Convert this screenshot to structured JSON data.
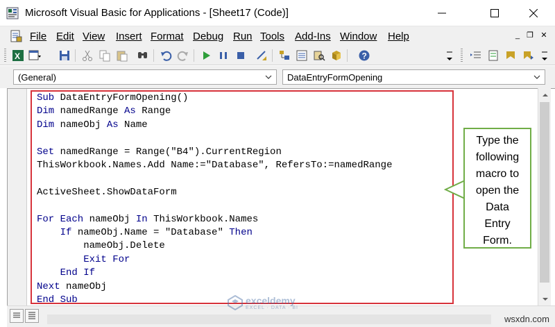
{
  "window": {
    "title": "Microsoft Visual Basic for Applications - [Sheet17 (Code)]",
    "app_icon": "vba-app-icon",
    "controls": [
      "minimize-icon",
      "maximize-icon",
      "close-icon"
    ]
  },
  "menu": {
    "items": [
      {
        "label": "File"
      },
      {
        "label": "Edit"
      },
      {
        "label": "View"
      },
      {
        "label": "Insert"
      },
      {
        "label": "Format"
      },
      {
        "label": "Debug"
      },
      {
        "label": "Run"
      },
      {
        "label": "Tools"
      },
      {
        "label": "Add-Ins"
      },
      {
        "label": "Window"
      },
      {
        "label": "Help"
      }
    ],
    "mdi_minimize": "_",
    "mdi_restore": "❐",
    "mdi_close": "✕"
  },
  "toolbar": {
    "icons": [
      "view-excel-icon",
      "insert-userform-icon",
      "save-icon",
      "cut-icon",
      "copy-icon",
      "paste-icon",
      "find-icon",
      "undo-icon",
      "redo-icon",
      "run-icon",
      "break-icon",
      "reset-icon",
      "design-mode-icon",
      "project-explorer-icon",
      "properties-window-icon",
      "object-browser-icon",
      "toolbox-icon",
      "help-icon"
    ]
  },
  "combos": {
    "object": "(General)",
    "procedure": "DataEntryFormOpening"
  },
  "code": {
    "lines": [
      [
        {
          "t": "Sub ",
          "k": true
        },
        {
          "t": "DataEntryFormOpening()"
        }
      ],
      [
        {
          "t": "Dim ",
          "k": true
        },
        {
          "t": "namedRange "
        },
        {
          "t": "As ",
          "k": true
        },
        {
          "t": "Range"
        }
      ],
      [
        {
          "t": "Dim ",
          "k": true
        },
        {
          "t": "nameObj "
        },
        {
          "t": "As ",
          "k": true
        },
        {
          "t": "Name"
        }
      ],
      [],
      [
        {
          "t": "Set ",
          "k": true
        },
        {
          "t": "namedRange = Range(\"B4\").CurrentRegion"
        }
      ],
      [
        {
          "t": "ThisWorkbook.Names.Add Name:=\"Database\", RefersTo:=namedRange"
        }
      ],
      [],
      [
        {
          "t": "ActiveSheet.ShowDataForm"
        }
      ],
      [],
      [
        {
          "t": "For Each ",
          "k": true
        },
        {
          "t": "nameObj "
        },
        {
          "t": "In ",
          "k": true
        },
        {
          "t": "ThisWorkbook.Names"
        }
      ],
      [
        {
          "t": "    "
        },
        {
          "t": "If ",
          "k": true
        },
        {
          "t": "nameObj.Name = \"Database\" "
        },
        {
          "t": "Then",
          "k": true
        }
      ],
      [
        {
          "t": "        nameObj.Delete"
        }
      ],
      [
        {
          "t": "        "
        },
        {
          "t": "Exit For",
          "k": true
        }
      ],
      [
        {
          "t": "    "
        },
        {
          "t": "End If",
          "k": true
        }
      ],
      [
        {
          "t": "Next ",
          "k": true
        },
        {
          "t": "nameObj"
        }
      ],
      [
        {
          "t": "End Sub",
          "k": true
        }
      ]
    ],
    "keyword_color": "#00008b",
    "frame_color": "#d7333b"
  },
  "callout": {
    "text": "Type the\nfollowing\nmacro to\nopen the\nData\nEntry\nForm.",
    "border_color": "#70ad47"
  },
  "watermark": {
    "name": "exceldemy",
    "tagline": "EXCEL · DATA · BI",
    "corner": "wsxdn.com"
  }
}
